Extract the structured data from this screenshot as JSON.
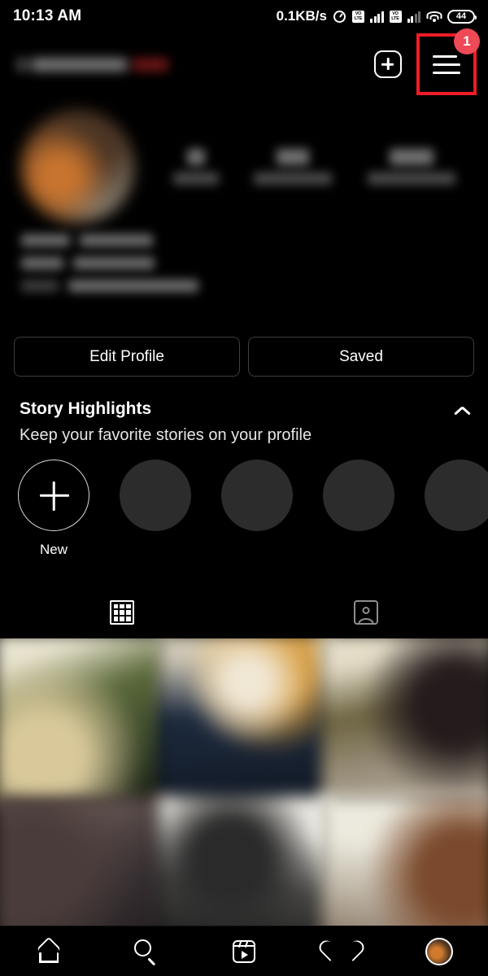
{
  "status_bar": {
    "time": "10:13 AM",
    "network_speed": "0.1KB/s",
    "alarm_icon": "alarm-clock-icon",
    "sim1_label": "VO LTE",
    "sim2_label": "VO LTE",
    "wifi_icon": "wifi-icon",
    "battery_level": "44"
  },
  "header": {
    "username": "",
    "create_icon": "plus-square-icon",
    "menu_icon": "hamburger-menu-icon",
    "menu_badge_count": "1",
    "highlight_color": "#ee1c25",
    "badge_color": "#ed4956"
  },
  "profile": {
    "avatar_alt": "profile-avatar",
    "stats": [
      {
        "value": "",
        "label": "posts"
      },
      {
        "value": "",
        "label": "followers"
      },
      {
        "value": "",
        "label": "following"
      }
    ],
    "bio_lines": [
      "",
      "",
      ""
    ]
  },
  "actions": {
    "edit_profile_label": "Edit Profile",
    "saved_label": "Saved"
  },
  "story_highlights": {
    "title": "Story Highlights",
    "subtitle": "Keep your favorite stories on your profile",
    "collapse_icon": "chevron-up-icon",
    "new_label": "New",
    "new_icon": "plus-icon",
    "placeholder_count": 4
  },
  "content_tabs": {
    "grid_tab_icon": "grid-icon",
    "tagged_tab_icon": "tagged-photos-icon",
    "active_tab": "grid"
  },
  "photo_grid": {
    "columns": 3,
    "cells": [
      {
        "id": "post-1"
      },
      {
        "id": "post-2"
      },
      {
        "id": "post-3"
      },
      {
        "id": "post-4"
      },
      {
        "id": "post-5"
      },
      {
        "id": "post-6"
      }
    ]
  },
  "bottom_nav": {
    "items": [
      {
        "name": "home",
        "icon": "home-icon",
        "active": false
      },
      {
        "name": "search",
        "icon": "search-icon",
        "active": false
      },
      {
        "name": "reels",
        "icon": "reels-icon",
        "active": false
      },
      {
        "name": "activity",
        "icon": "heart-icon",
        "active": false
      },
      {
        "name": "profile",
        "icon": "avatar-icon",
        "active": true
      }
    ]
  }
}
